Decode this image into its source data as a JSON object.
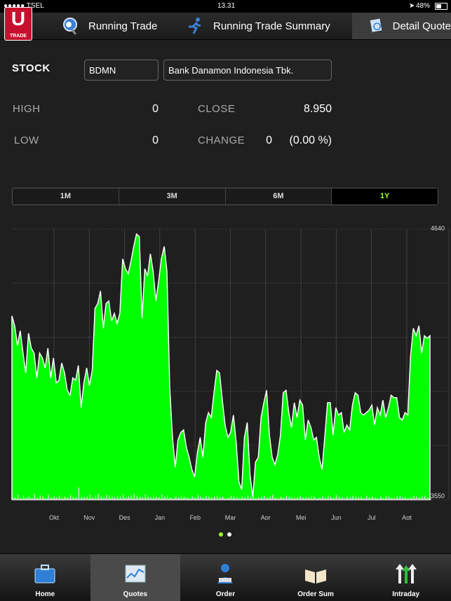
{
  "status": {
    "carrier": "●●●●● TSEL",
    "time": "13.31",
    "battery": "48%"
  },
  "nav": {
    "logo": "U",
    "logo_sub": "TRADE",
    "tab1": "Running Trade",
    "tab2": "Running Trade Summary",
    "tab3": "Detail Quote"
  },
  "quote": {
    "stock_label": "STOCK",
    "code": "BDMN",
    "name": "Bank Danamon Indonesia Tbk.",
    "high_label": "HIGH",
    "high": "0",
    "close_label": "CLOSE",
    "close": "8.950",
    "low_label": "LOW",
    "low": "0",
    "change_label": "CHANGE",
    "change": "0",
    "change_pct": "(0.00 %)"
  },
  "periods": [
    "1M",
    "3M",
    "6M",
    "1Y"
  ],
  "active_period": "1Y",
  "chart_data": {
    "type": "area",
    "ylim": [
      3550,
      4640
    ],
    "ytick_labels": [
      "4640",
      "3550"
    ],
    "x_labels": [
      "Okt",
      "Nov",
      "Des",
      "Jan",
      "Feb",
      "Mar",
      "Apr",
      "Mei",
      "Jun",
      "Jul",
      "Agt"
    ],
    "values": [
      4290,
      4250,
      4170,
      4230,
      4140,
      4060,
      4220,
      4160,
      4140,
      4040,
      4140,
      4120,
      4080,
      4160,
      4040,
      4120,
      4020,
      4030,
      4100,
      4060,
      3990,
      3970,
      4040,
      4030,
      4090,
      3920,
      4020,
      4080,
      4010,
      4070,
      4320,
      4340,
      4390,
      4240,
      4340,
      4350,
      4270,
      4300,
      4260,
      4300,
      4520,
      4480,
      4460,
      4510,
      4570,
      4620,
      4610,
      4280,
      4480,
      4450,
      4540,
      4470,
      4350,
      4430,
      4520,
      4570,
      4470,
      4000,
      3800,
      3680,
      3790,
      3820,
      3830,
      3760,
      3720,
      3670,
      3640,
      3740,
      3800,
      3720,
      3860,
      3900,
      3880,
      3980,
      4070,
      4060,
      3950,
      3850,
      3800,
      3820,
      3890,
      3780,
      3620,
      3590,
      3800,
      3860,
      3650,
      3560,
      3700,
      3720,
      3880,
      3940,
      3990,
      3810,
      3720,
      3690,
      3730,
      3810,
      3980,
      3990,
      3900,
      3840,
      3940,
      3880,
      3950,
      3930,
      3790,
      3870,
      3840,
      3790,
      3800,
      3720,
      3670,
      3800,
      3940,
      3940,
      3810,
      3920,
      3890,
      3900,
      3820,
      3850,
      3830,
      3930,
      3980,
      3970,
      3900,
      3890,
      3900,
      3910,
      3930,
      3850,
      3920,
      3890,
      3950,
      3880,
      3920,
      3970,
      3960,
      3960,
      3880,
      3870,
      3900,
      3890,
      4130,
      4240,
      4210,
      4250,
      4140,
      4210,
      4200,
      4210
    ],
    "volume": [
      4,
      3,
      6,
      2,
      5,
      3,
      4,
      2,
      7,
      3,
      5,
      4,
      2,
      6,
      3,
      4,
      3,
      5,
      2,
      4,
      3,
      6,
      4,
      3,
      14,
      5,
      3,
      4,
      6,
      3,
      5,
      7,
      4,
      3,
      6,
      5,
      4,
      3,
      5,
      4,
      6,
      3,
      4,
      5,
      7,
      5,
      4,
      3,
      6,
      4,
      3,
      5,
      4,
      3,
      6,
      4,
      5,
      3,
      2,
      4,
      3,
      5,
      4,
      3,
      2,
      4,
      3,
      6,
      4,
      3,
      5,
      4,
      3,
      4,
      5,
      3,
      4,
      2,
      3,
      5,
      4,
      3,
      2,
      4,
      3,
      5,
      3,
      4,
      2,
      3,
      4,
      5,
      3,
      4,
      6,
      3,
      2,
      4,
      3,
      5,
      4,
      3,
      2,
      4,
      5,
      3,
      4,
      3,
      5,
      4,
      2,
      3,
      4,
      3,
      5,
      4,
      3,
      6,
      4,
      3,
      2,
      4,
      3,
      5,
      4,
      3,
      4,
      2,
      5,
      3,
      4,
      3,
      2,
      4,
      3,
      5,
      4,
      3,
      2,
      4,
      5,
      3,
      4,
      2,
      3,
      5,
      4,
      3,
      4,
      5,
      3,
      2
    ],
    "fill_color": "#00ff00"
  },
  "pager": {
    "active_color": "#9cff2e",
    "inactive_color": "#ffffff"
  },
  "tabs": [
    {
      "name": "home",
      "label": "Home",
      "icon": "briefcase-icon"
    },
    {
      "name": "quotes",
      "label": "Quotes",
      "icon": "chart-icon"
    },
    {
      "name": "order",
      "label": "Order",
      "icon": "person-icon"
    },
    {
      "name": "order-sum",
      "label": "Order Sum",
      "icon": "book-icon"
    },
    {
      "name": "intraday",
      "label": "Intraday",
      "icon": "arrows-icon"
    }
  ],
  "active_tab": "Quotes"
}
